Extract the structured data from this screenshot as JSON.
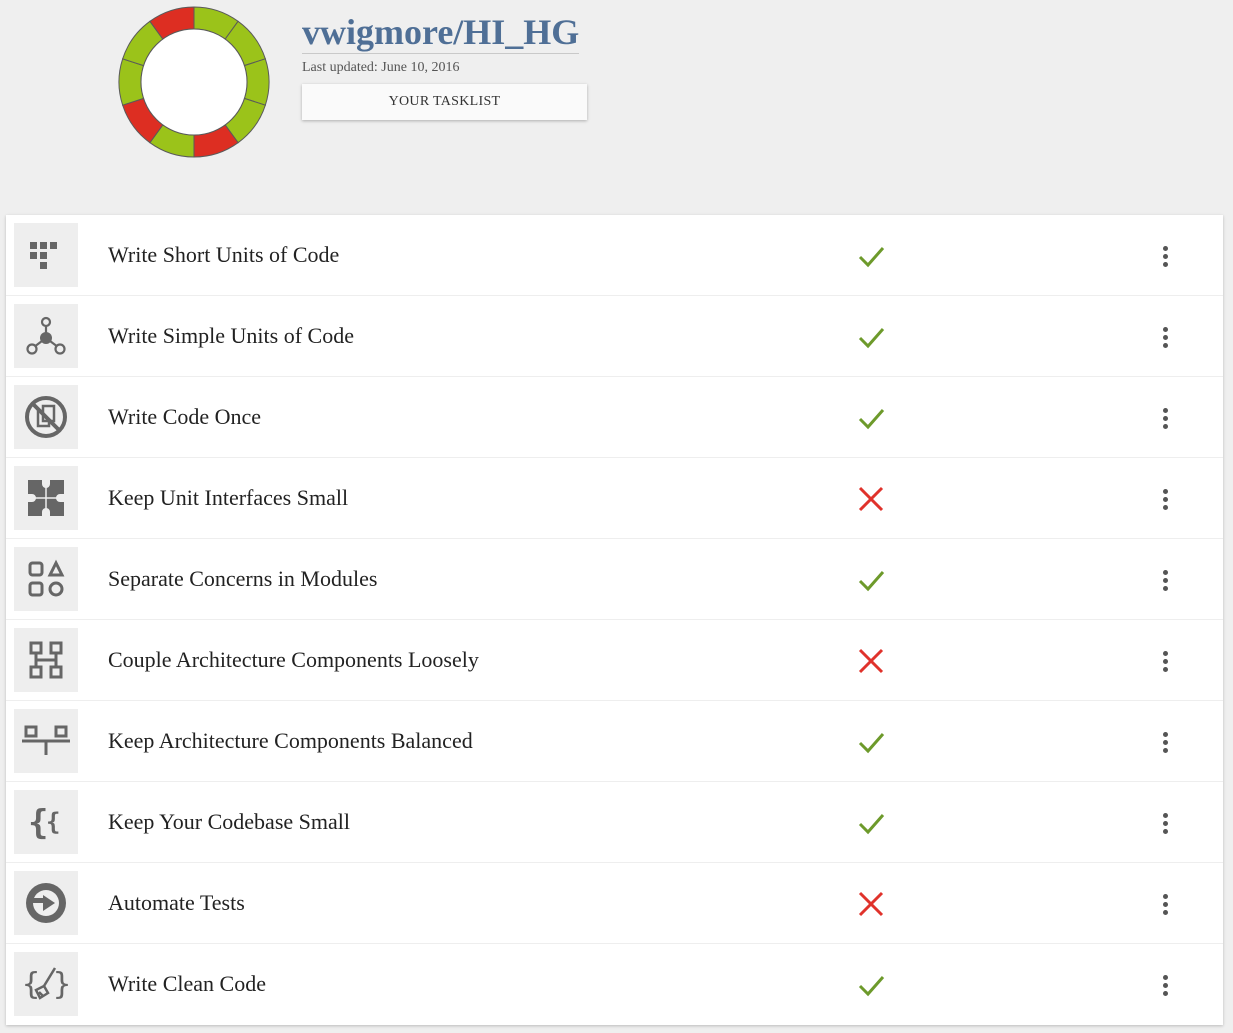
{
  "header": {
    "repo_name": "vwigmore/HI_HG",
    "last_updated": "Last updated: June 10, 2016",
    "tasklist_button": "YOUR TASKLIST"
  },
  "colors": {
    "pass": "#9bc31a",
    "fail": "#dd2e22",
    "check": "#6d9a2b",
    "cross": "#e0322b",
    "repo_title": "#4f6f96"
  },
  "guidelines": [
    {
      "label": "Write Short Units of Code",
      "icon": "short-units-icon",
      "status": "pass"
    },
    {
      "label": "Write Simple Units of Code",
      "icon": "simple-units-icon",
      "status": "pass"
    },
    {
      "label": "Write Code Once",
      "icon": "no-duplication-icon",
      "status": "pass"
    },
    {
      "label": "Keep Unit Interfaces Small",
      "icon": "puzzle-icon",
      "status": "fail"
    },
    {
      "label": "Separate Concerns in Modules",
      "icon": "modules-icon",
      "status": "pass"
    },
    {
      "label": "Couple Architecture Components Loosely",
      "icon": "loose-coupling-icon",
      "status": "fail"
    },
    {
      "label": "Keep Architecture Components Balanced",
      "icon": "balance-icon",
      "status": "pass"
    },
    {
      "label": "Keep Your Codebase Small",
      "icon": "curly-braces-icon",
      "status": "pass"
    },
    {
      "label": "Automate Tests",
      "icon": "play-test-icon",
      "status": "fail"
    },
    {
      "label": "Write Clean Code",
      "icon": "clean-code-icon",
      "status": "pass"
    }
  ],
  "score_ring": [
    "pass",
    "pass",
    "pass",
    "pass",
    "fail",
    "pass",
    "fail",
    "pass",
    "pass",
    "fail"
  ]
}
